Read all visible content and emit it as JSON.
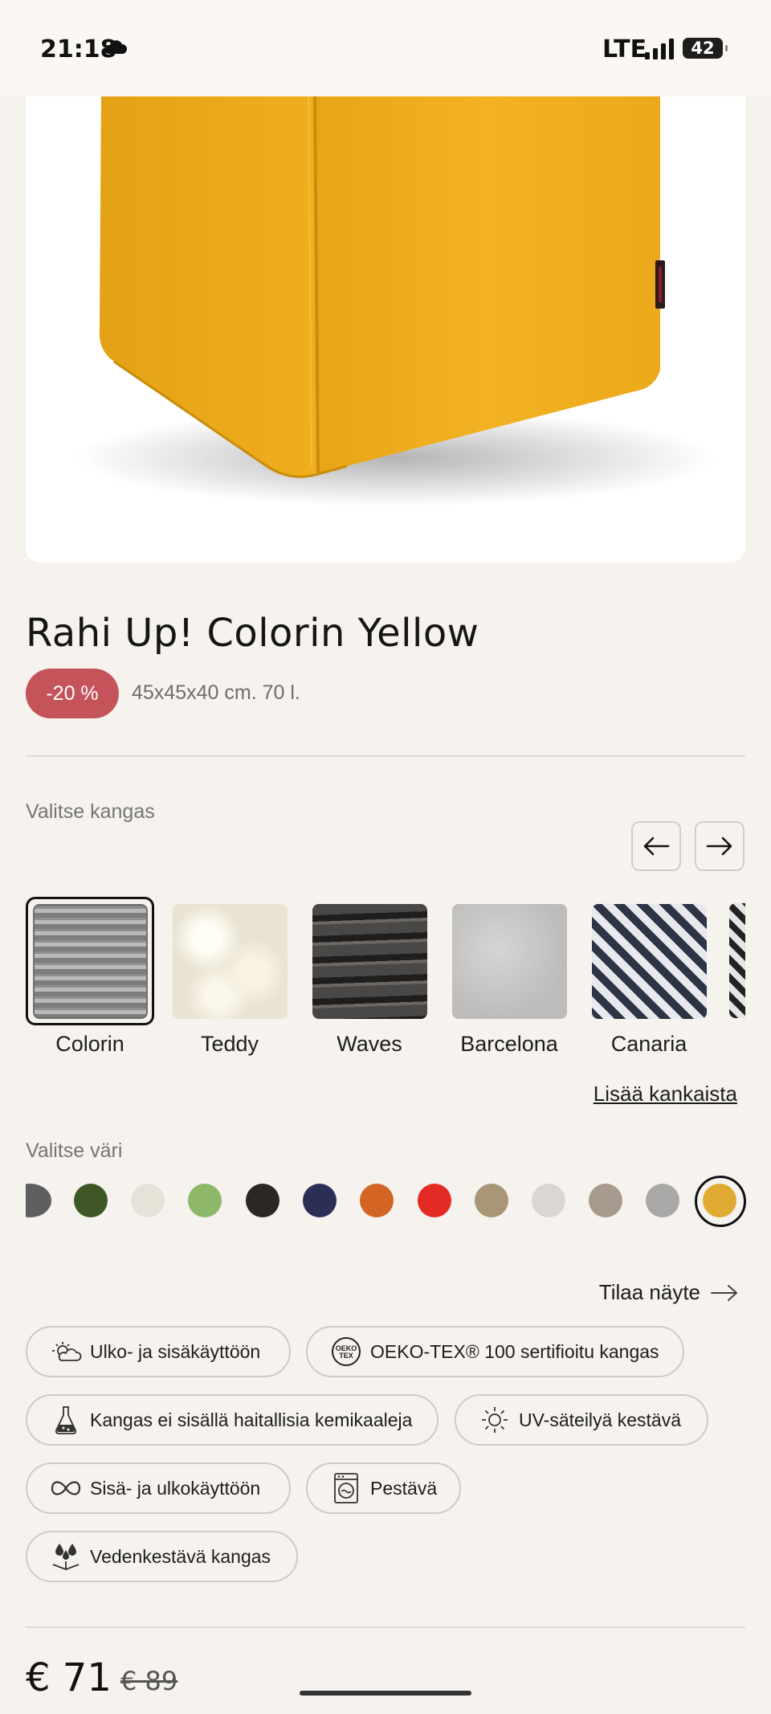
{
  "status_bar": {
    "time": "21:18",
    "network": "LTE",
    "battery": "42",
    "weather_icon": "cloud-icon"
  },
  "product": {
    "title": "Rahi Up! Colorin Yellow",
    "discount_badge": "-20 %",
    "dimensions": "45x45x40 cm. 70 l.",
    "image_alt": "yellow cube pouf"
  },
  "fabric_section": {
    "label": "Valitse kangas",
    "prev_icon": "arrow-left-icon",
    "next_icon": "arrow-right-icon",
    "fabrics": [
      {
        "name": "Colorin",
        "selected": true
      },
      {
        "name": "Teddy",
        "selected": false
      },
      {
        "name": "Waves",
        "selected": false
      },
      {
        "name": "Barcelona",
        "selected": false
      },
      {
        "name": "Canaria",
        "selected": false
      }
    ],
    "more_link": "Lisää kankaista"
  },
  "color_section": {
    "label": "Valitse väri",
    "colors": [
      "#5e5e5e",
      "#3f5626",
      "#e6e2d8",
      "#8db86a",
      "#2a2725",
      "#2c2f55",
      "#d46424",
      "#e42a25",
      "#a89676",
      "#dad7d3",
      "#a89a8c",
      "#a9a8a6",
      "#e1ab33"
    ],
    "selected_color": "#e1ab33"
  },
  "sample": {
    "label": "Tilaa näyte",
    "icon": "arrow-right-icon"
  },
  "features": [
    {
      "label": "Ulko- ja sisäkäyttöön",
      "icon": "sun-cloud-icon"
    },
    {
      "label": "OEKO-TEX® 100 sertifioitu kangas",
      "icon": "oeko-tex-icon",
      "icon_text": "OEKO TEX"
    },
    {
      "label": "Kangas ei sisällä haitallisia kemikaaleja",
      "icon": "flask-icon"
    },
    {
      "label": "UV-säteilyä kestävä",
      "icon": "sun-icon"
    },
    {
      "label": "Sisä- ja ulkokäyttöön",
      "icon": "infinity-icon"
    },
    {
      "label": "Pestävä",
      "icon": "washing-machine-icon"
    },
    {
      "label": "Vedenkestävä kangas",
      "icon": "water-drops-icon"
    }
  ],
  "pricing": {
    "price": "€ 71",
    "old_price": "€ 89"
  }
}
